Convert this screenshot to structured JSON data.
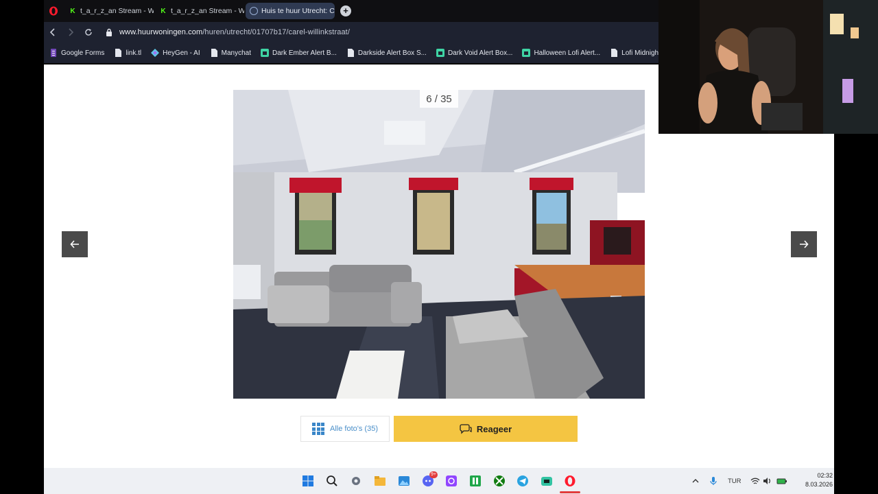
{
  "browser": {
    "tabs": [
      {
        "title": "t_a_r_z_an Stream - Watch",
        "icon": "kick-icon"
      },
      {
        "title": "t_a_r_z_an Stream - Watch",
        "icon": "kick-icon"
      },
      {
        "title": "Huis te huur Utrecht: Care",
        "icon": "globe-icon",
        "active": true
      }
    ],
    "url_domain": "www.huurwoningen.com",
    "url_path": "/huren/utrecht/01707b17/carel-willinkstraat/",
    "bookmarks": [
      "Google Forms",
      "link.tl",
      "HeyGen - AI",
      "Manychat",
      "Dark Ember Alert B...",
      "Darkside Alert Box S...",
      "Dark Void Alert Box...",
      "Halloween Lofi Alert...",
      "Lofi Midnight Widg..."
    ]
  },
  "gallery": {
    "counter": "6 / 35",
    "all_photos_label": "Alle foto's (35)",
    "respond_label": "Reageer"
  },
  "taskbar": {
    "language": "TUR",
    "time": "02:32",
    "date": "8.03.2026",
    "discord_badge": "9+"
  },
  "colors": {
    "accent_yellow": "#f4c542",
    "link_blue": "#3a86c8",
    "active_tab": "#2f3a52",
    "arrow_bg": "#4a4a4a"
  }
}
